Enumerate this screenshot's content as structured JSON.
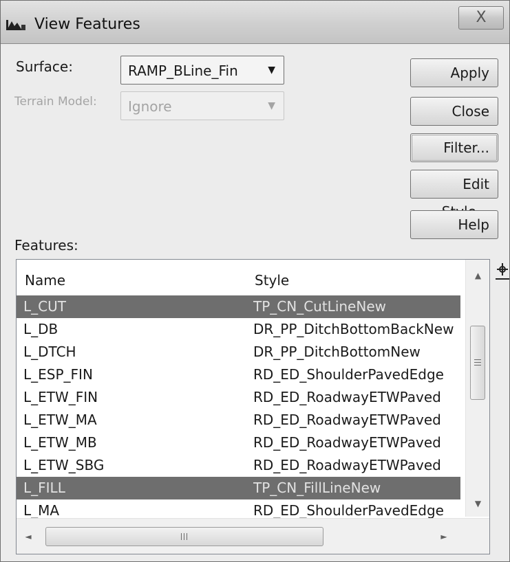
{
  "window": {
    "title": "View Features",
    "close_glyph": "X",
    "icon": "window-app-icon"
  },
  "form": {
    "surface_label": "Surface:",
    "surface_value": "RAMP_BLine_Fin",
    "triangle_mode_label": "Terrain Model:",
    "triangle_mode_value": "Ignore",
    "features_label": "Features:",
    "combo_arrow": "▼"
  },
  "buttons": {
    "apply": "Apply",
    "close": "Close",
    "filter": "Filter...",
    "edit_style": "Edit Style...",
    "help": "Help"
  },
  "list": {
    "columns": [
      "Name",
      "Style"
    ],
    "rows": [
      {
        "name": "L_CUT",
        "style": "TP_CN_CutLineNew",
        "selected": true
      },
      {
        "name": "L_DB",
        "style": "DR_PP_DitchBottomBackNew",
        "selected": false
      },
      {
        "name": "L_DTCH",
        "style": "DR_PP_DitchBottomNew",
        "selected": false
      },
      {
        "name": "L_ESP_FIN",
        "style": "RD_ED_ShoulderPavedEdge",
        "selected": false
      },
      {
        "name": "L_ETW_FIN",
        "style": "RD_ED_RoadwayETWPaved",
        "selected": false
      },
      {
        "name": "L_ETW_MA",
        "style": "RD_ED_RoadwayETWPaved",
        "selected": false
      },
      {
        "name": "L_ETW_MB",
        "style": "RD_ED_RoadwayETWPaved",
        "selected": false
      },
      {
        "name": "L_ETW_SBG",
        "style": "RD_ED_RoadwayETWPaved",
        "selected": false
      },
      {
        "name": "L_FILL",
        "style": "TP_CN_FillLineNew",
        "selected": true
      },
      {
        "name": "L_MA",
        "style": "RD_ED_ShoulderPavedEdge",
        "selected": false
      }
    ]
  },
  "scrollbars": {
    "up_arrow": "▲",
    "down_arrow": "▼",
    "left_arrow": "◄",
    "right_arrow": "►",
    "vertical_position": 0.25,
    "horizontal_position": 0.0
  },
  "icons": {
    "locate": "crosshair-icon"
  },
  "colors": {
    "selection": "#6e6e6e",
    "window_bg": "#ececec",
    "disabled_text": "#a4a4a4"
  }
}
